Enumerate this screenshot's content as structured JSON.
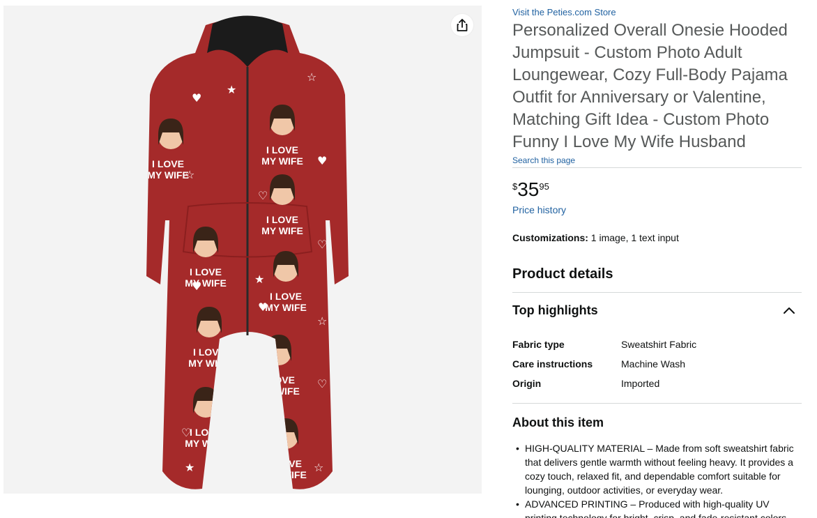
{
  "store": {
    "link_text": "Visit the Peties.com Store"
  },
  "product": {
    "title": "Personalized Overall Onesie Hooded Jumpsuit - Custom Photo Adult Loungewear, Cozy Full-Body Pajama Outfit for Anniversary or Valentine, Matching Gift Idea - Custom Photo Funny I Love My Wife Husband",
    "search_page_link": "Search this page",
    "price": {
      "symbol": "$",
      "whole": "35",
      "fraction": "95"
    },
    "price_history_link": "Price history",
    "customizations": {
      "label": "Customizations:",
      "value": "1 image, 1 text input"
    },
    "print_text": [
      "I LOVE",
      "MY WIFE"
    ]
  },
  "product_details": {
    "heading": "Product details",
    "top_highlights": {
      "label": "Top highlights",
      "rows": [
        {
          "key": "Fabric type",
          "value": "Sweatshirt Fabric"
        },
        {
          "key": "Care instructions",
          "value": "Machine Wash"
        },
        {
          "key": "Origin",
          "value": "Imported"
        }
      ]
    }
  },
  "about": {
    "heading": "About this item",
    "bullets": [
      "HIGH-QUALITY MATERIAL – Made from soft sweatshirt fabric that delivers gentle warmth without feeling heavy. It provides a cozy touch, relaxed fit, and dependable comfort suitable for lounging, outdoor activities, or everyday wear.",
      "ADVANCED PRINTING – Produced with high-quality UV printing technology for bright, crisp, and fade-resistant colors"
    ]
  },
  "icons": {
    "share": "share-icon",
    "collapse": "chevron-up-icon"
  },
  "colors": {
    "link": "#2162a1",
    "title": "#565959",
    "fabric": "#a52a2a",
    "divider": "#d5d9d9"
  }
}
